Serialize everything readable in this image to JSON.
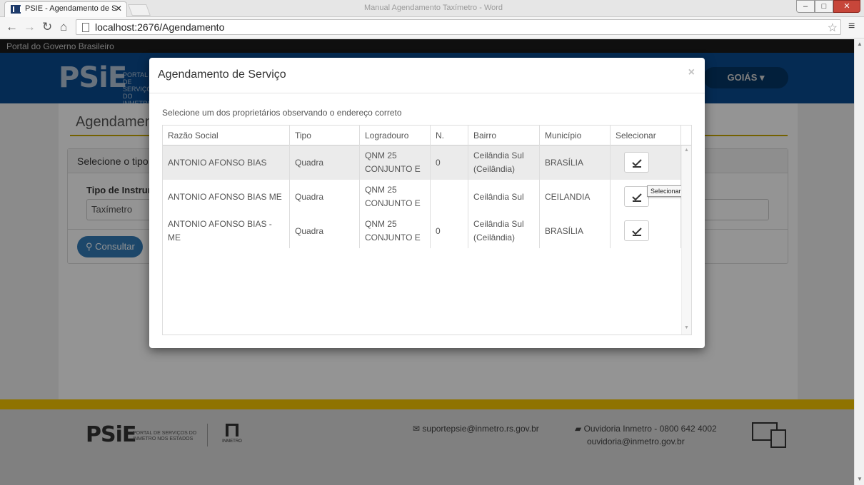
{
  "browser": {
    "tab_title": "PSIE - Agendamento de S",
    "window_title": "Manual Agendamento Taxímetro - Word",
    "url": "localhost:2676/Agendamento"
  },
  "page": {
    "gov_bar": "Portal do Governo Brasileiro",
    "logo": "PSiE",
    "logo_sub": "PORTAL DE SERVIÇOS DO INMETRO",
    "state_button": "GOIÁS ▾",
    "title": "Agendamento",
    "panel_heading": "Selecione o tipo",
    "field_label": "Tipo de Instrum",
    "field_value": "Taxímetro",
    "consultar_button": "Consultar"
  },
  "modal": {
    "title": "Agendamento de Serviço",
    "close": "×",
    "instruction": "Selecione um dos proprietários observando o endereço correto",
    "columns": [
      "Razão Social",
      "Tipo",
      "Logradouro",
      "N.",
      "Bairro",
      "Município",
      "Selecionar"
    ],
    "rows": [
      [
        "ANTONIO AFONSO BIAS",
        "Quadra",
        "QNM 25 CONJUNTO E",
        "0",
        "Ceilândia Sul (Ceilândia)",
        "BRASÍLIA"
      ],
      [
        "ANTONIO AFONSO BIAS ME",
        "Quadra",
        "QNM 25 CONJUNTO E",
        "",
        "Ceilândia Sul",
        "CEILANDIA"
      ],
      [
        "ANTONIO AFONSO BIAS - ME",
        "Quadra",
        "QNM 25 CONJUNTO E",
        "0",
        "Ceilândia Sul (Ceilândia)",
        "BRASÍLIA"
      ]
    ],
    "tooltip": "Selecionar"
  },
  "footer": {
    "logo": "PSiE",
    "logo_sub": "PORTAL DE SERVIÇOS DO INMETRO NOS ESTADOS",
    "inmetro": "INMETRO",
    "email": "suportepsie@inmetro.rs.gov.br",
    "ouvidoria": "Ouvidoria Inmetro - 0800 642 4002",
    "ouvidoria_email": "ouvidoria@inmetro.gov.br"
  },
  "icons": {
    "back": "back-arrow-icon",
    "forward": "forward-arrow-icon",
    "reload": "reload-icon",
    "home": "home-icon",
    "bookmark": "star-icon",
    "menu": "hamburger-icon",
    "select": "check-icon",
    "search": "search-icon",
    "mail": "mail-icon",
    "chat": "chat-icon"
  },
  "colors": {
    "header_blue": "#0a4b8f",
    "accent_yellow": "#f6c700",
    "primary_button": "#337ab7"
  }
}
